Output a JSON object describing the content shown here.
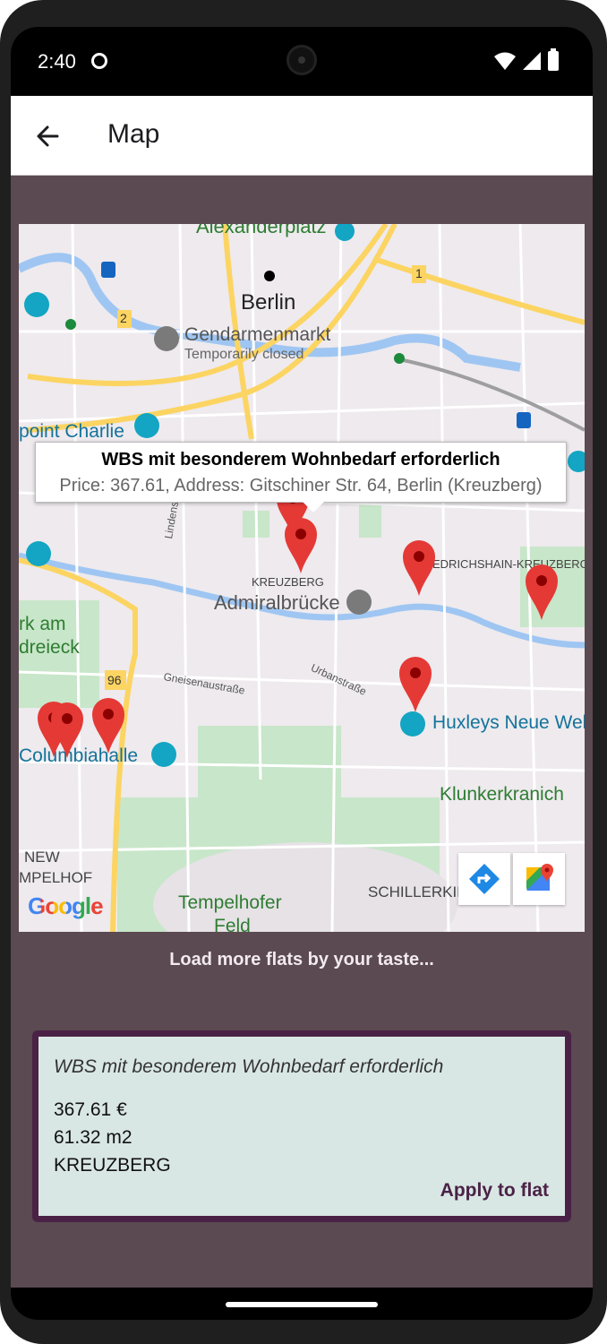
{
  "status_bar": {
    "time": "2:40"
  },
  "app_bar": {
    "title": "Map"
  },
  "map": {
    "labels": {
      "alexanderplatz": "Alexanderplatz",
      "berlin": "Berlin",
      "gendarmenmarkt": "Gendarmenmarkt",
      "temporarily_closed": "Temporarily closed",
      "checkpoint": "point Charlie",
      "kreuzberg": "KREUZBERG",
      "friedrichshain": "EDRICHSHAIN-KREUZBERG",
      "admiralbruecke": "Admiralbrücke",
      "lindenstrasse": "Lindenstraße",
      "park_am": "rk am",
      "dreieck": "dreieck",
      "gneisenau": "Gneisenaustraße",
      "urbanstrasse": "Urbanstraße",
      "huxleys": "Huxleys Neue Wel",
      "columbiahalle": "Columbiahalle",
      "klunkerkranich": "Klunkerkranich",
      "new": "NEW",
      "tempelhof_district": "MPELHOF",
      "tempelhofer": "Tempelhofer",
      "feld": "Feld",
      "schillerkiez": "SCHILLERKIEZ",
      "road_1": "1",
      "road_2": "2",
      "road_96": "96"
    },
    "info_window": {
      "title": "WBS mit besonderem Wohnbedarf erforderlich",
      "snippet": "Price: 367.61, Address: Gitschiner Str. 64, Berlin (Kreuzberg)"
    },
    "google_logo": "Google",
    "marker_color": "#e53935"
  },
  "load_more_label": "Load more flats by your taste...",
  "flat_card": {
    "title": "WBS mit besonderem Wohnbedarf erforderlich",
    "price": "367.61 €",
    "area": "61.32 m2",
    "district": "KREUZBERG",
    "apply_label": "Apply to flat"
  },
  "colors": {
    "background": "#5b4a51",
    "card_border": "#4a2246",
    "card_background": "#d9e7e4",
    "park_green": "#c8e6c9",
    "road_yellow": "#fcd462"
  }
}
